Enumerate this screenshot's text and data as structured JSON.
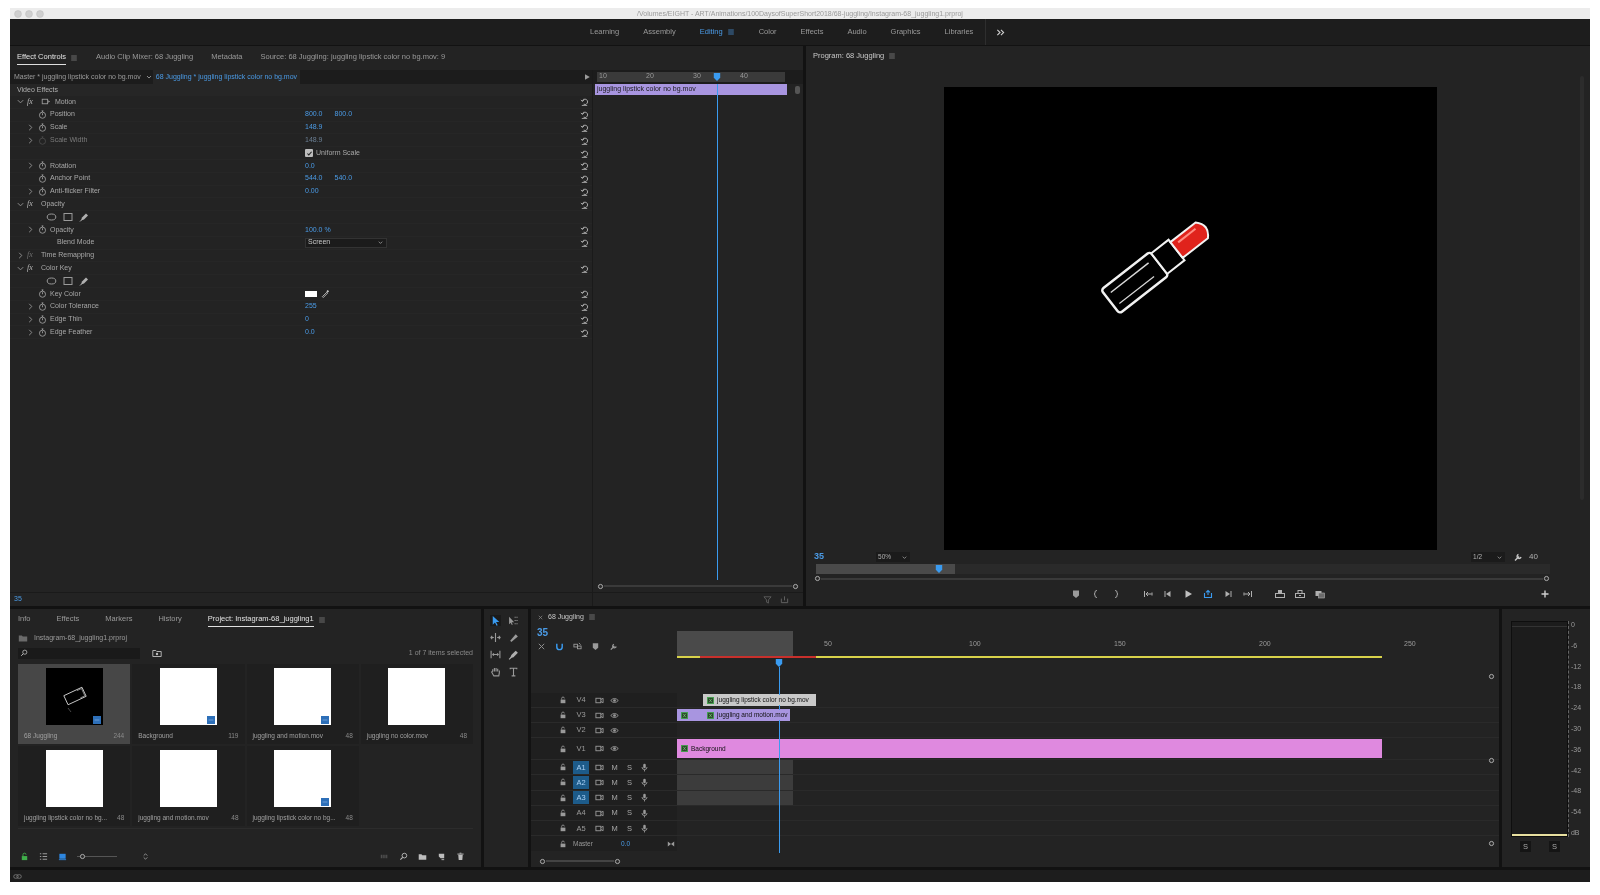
{
  "window": {
    "title": "/Volumes/EIGHT - ART/Animations/100DaysofSuperShort2018/68-juggling/Instagram-68_juggling1.prproj"
  },
  "workspaces": [
    {
      "label": "Learning",
      "selected": false
    },
    {
      "label": "Assembly",
      "selected": false
    },
    {
      "label": "Editing",
      "selected": true
    },
    {
      "label": "Color",
      "selected": false
    },
    {
      "label": "Effects",
      "selected": false
    },
    {
      "label": "Audio",
      "selected": false
    },
    {
      "label": "Graphics",
      "selected": false
    },
    {
      "label": "Libraries",
      "selected": false
    }
  ],
  "effect_controls": {
    "tabs": [
      {
        "label": "Effect Controls",
        "selected": true
      },
      {
        "label": "Audio Clip Mixer: 68 Juggling",
        "selected": false
      },
      {
        "label": "Metadata",
        "selected": false
      },
      {
        "label": "Source: 68 Juggling: juggling lipstick color no bg.mov: 9",
        "selected": false
      }
    ],
    "master_clip": "Master * juggling lipstick color no bg.mov",
    "sequence_clip": "68 Juggling * juggling lipstick color no bg.mov",
    "section": "Video Effects",
    "rows": [
      {
        "kind": "effect",
        "badge": "fx",
        "label": "Motion",
        "expanded": true,
        "disabled": false,
        "transform_icon": true,
        "resettable": true
      },
      {
        "kind": "property",
        "label": "Position",
        "expandable": false,
        "disabled": false,
        "values": [
          "800.0",
          "800.0"
        ]
      },
      {
        "kind": "property",
        "label": "Scale",
        "expandable": true,
        "disabled": false,
        "values": [
          "148.9"
        ]
      },
      {
        "kind": "property",
        "label": "Scale Width",
        "expandable": true,
        "disabled": true,
        "values": [
          "148.9"
        ]
      },
      {
        "kind": "checkbox",
        "label": "Uniform Scale",
        "checked": true
      },
      {
        "kind": "property",
        "label": "Rotation",
        "expandable": true,
        "disabled": false,
        "values": [
          "0.0"
        ]
      },
      {
        "kind": "property",
        "label": "Anchor Point",
        "expandable": false,
        "disabled": false,
        "values": [
          "544.0",
          "540.0"
        ]
      },
      {
        "kind": "property",
        "label": "Anti-flicker Filter",
        "expandable": true,
        "disabled": false,
        "values": [
          "0.00"
        ]
      },
      {
        "kind": "effect",
        "badge": "fx",
        "label": "Opacity",
        "expanded": true,
        "disabled": false,
        "transform_icon": false,
        "resettable": true
      },
      {
        "kind": "masks"
      },
      {
        "kind": "property",
        "label": "Opacity",
        "expandable": true,
        "disabled": false,
        "values": [
          "100.0 %"
        ]
      },
      {
        "kind": "dropdown",
        "label": "Blend Mode",
        "value": "Screen"
      },
      {
        "kind": "effect",
        "badge": "fx",
        "label": "Time Remapping",
        "expanded": false,
        "disabled": true,
        "transform_icon": false,
        "resettable": false
      },
      {
        "kind": "effect",
        "badge": "fx",
        "label": "Color Key",
        "expanded": true,
        "disabled": false,
        "transform_icon": false,
        "resettable": true
      },
      {
        "kind": "masks"
      },
      {
        "kind": "color",
        "label": "Key Color",
        "color": "#ffffff"
      },
      {
        "kind": "property",
        "label": "Color Tolerance",
        "expandable": true,
        "disabled": false,
        "values": [
          "255"
        ]
      },
      {
        "kind": "property",
        "label": "Edge Thin",
        "expandable": true,
        "disabled": false,
        "values": [
          "0"
        ]
      },
      {
        "kind": "property",
        "label": "Edge Feather",
        "expandable": true,
        "disabled": false,
        "values": [
          "0.0"
        ]
      }
    ],
    "ruler": [
      "10",
      "20",
      "30",
      "40"
    ],
    "clip": "juggling lipstick color no bg.mov",
    "timecode": "35"
  },
  "program": {
    "title": "Program: 68 Juggling",
    "timecode": "35",
    "zoom": "50%",
    "resolution": "1/2",
    "duration": "40"
  },
  "project": {
    "tabs": [
      {
        "label": "Info",
        "selected": false
      },
      {
        "label": "Effects",
        "selected": false
      },
      {
        "label": "Markers",
        "selected": false
      },
      {
        "label": "History",
        "selected": false
      },
      {
        "label": "Project: Instagram-68_juggling1",
        "selected": true
      }
    ],
    "file": "Instagram-68_juggling1.prproj",
    "selection_count": "1 of 7 items selected",
    "items": [
      {
        "name": "68 Juggling",
        "duration": "244",
        "selected": true,
        "kind": "picture",
        "badge": true
      },
      {
        "name": "Background",
        "duration": "119",
        "selected": false,
        "kind": "blank",
        "badge": true
      },
      {
        "name": "juggling and motion.mov",
        "duration": "48",
        "selected": false,
        "kind": "blank",
        "badge": true
      },
      {
        "name": "juggling no color.mov",
        "duration": "48",
        "selected": false,
        "kind": "blank",
        "badge": false
      },
      {
        "name": "juggling lipstick color no bg...",
        "duration": "48",
        "selected": false,
        "kind": "blank",
        "badge": false
      },
      {
        "name": "juggling and motion.mov",
        "duration": "48",
        "selected": false,
        "kind": "blank",
        "badge": false
      },
      {
        "name": "juggling lipstick color no bg...",
        "duration": "48",
        "selected": false,
        "kind": "blank",
        "badge": true
      }
    ],
    "zoom_slider": {
      "level": 0.05
    }
  },
  "timeline": {
    "title": "68 Juggling",
    "timecode": "35",
    "ruler": [
      "50",
      "100",
      "150",
      "200",
      "250"
    ],
    "video_tracks": [
      {
        "label": "V4",
        "targeted": false,
        "clips": [
          {
            "name": "juggling lipstick color no bg.mov",
            "color": "#c9c9c9"
          }
        ]
      },
      {
        "label": "V3",
        "targeted": false,
        "clips": [
          {
            "color": "#a895e0"
          },
          {
            "name": "juggling and motion.mov",
            "color": "#a895e0"
          }
        ]
      },
      {
        "label": "V2",
        "targeted": false
      },
      {
        "label": "V1",
        "targeted": false,
        "clips": [
          {
            "name": "Background",
            "color": "#df89df"
          }
        ]
      }
    ],
    "audio_tracks": [
      {
        "label": "A1",
        "targeted": true,
        "mute": "M",
        "solo": "S"
      },
      {
        "label": "A2",
        "targeted": true,
        "mute": "M",
        "solo": "S"
      },
      {
        "label": "A3",
        "targeted": true,
        "mute": "M",
        "solo": "S"
      },
      {
        "label": "A4",
        "targeted": false,
        "mute": "M",
        "solo": "S"
      },
      {
        "label": "A5",
        "targeted": false,
        "mute": "M",
        "solo": "S"
      }
    ],
    "master": {
      "label": "Master",
      "value": "0.0"
    }
  },
  "meter": {
    "scale": [
      "0",
      "-6",
      "-12",
      "-18",
      "-24",
      "-30",
      "-36",
      "-42",
      "-48",
      "-54",
      "dB"
    ],
    "solo_buttons": [
      "S",
      "S"
    ]
  }
}
